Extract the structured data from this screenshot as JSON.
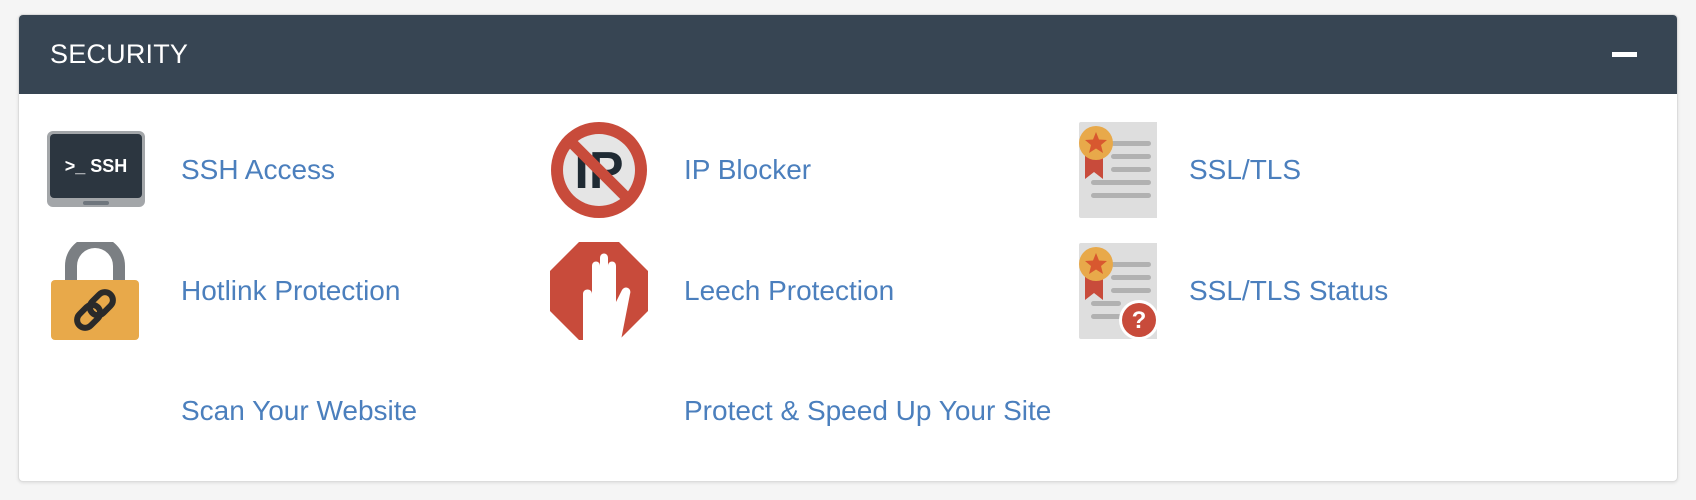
{
  "section": {
    "title": "SECURITY",
    "collapse_icon": "minus-icon"
  },
  "items": [
    {
      "label": "SSH Access",
      "icon": "ssh-terminal-icon"
    },
    {
      "label": "IP Blocker",
      "icon": "ip-blocker-icon"
    },
    {
      "label": "SSL/TLS",
      "icon": "certificate-icon"
    },
    {
      "label": "Hotlink Protection",
      "icon": "padlock-link-icon"
    },
    {
      "label": "Leech Protection",
      "icon": "stop-hand-icon"
    },
    {
      "label": "SSL/TLS Status",
      "icon": "certificate-status-icon"
    },
    {
      "label": "Scan Your Website"
    },
    {
      "label": "Protect & Speed Up Your Site"
    }
  ],
  "icon_text": {
    "ssh": ">_ SSH",
    "ip": "IP",
    "question": "?"
  },
  "colors": {
    "header_bg": "#374553",
    "header_text": "#ffffff",
    "link": "#4b7fbd",
    "panel_bg": "#ffffff",
    "page_bg": "#f5f5f5",
    "icon_red": "#c84b3b",
    "icon_gold": "#e8a94a"
  }
}
